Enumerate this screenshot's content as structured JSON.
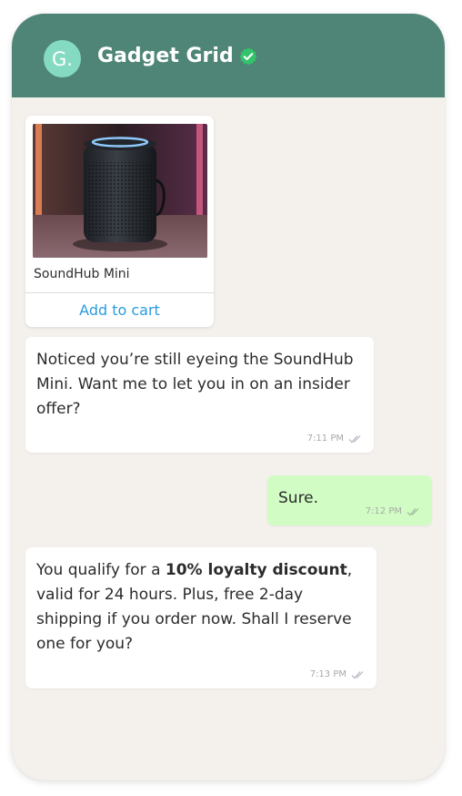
{
  "header": {
    "avatar_letter": "G.",
    "title": "Gadget Grid"
  },
  "product_card": {
    "name": "SoundHub Mini",
    "button_label": "Add to cart"
  },
  "messages": [
    {
      "direction": "incoming",
      "text": "Noticed you’re still eyeing the SoundHub Mini. Want me to let you in on an insider offer?",
      "time": "7:11 PM"
    },
    {
      "direction": "outgoing",
      "text": "Sure.",
      "time": "7:12 PM"
    },
    {
      "direction": "incoming",
      "text_before": "You qualify for a ",
      "text_bold": "10% loyalty discount",
      "text_after": ", valid for 24 hours. Plus, free 2-day shipping if you order now. Shall I reserve one for you?",
      "time": "7:13 PM"
    }
  ],
  "colors": {
    "header_bg": "#4f8577",
    "avatar_bg": "#85dbc1",
    "chat_bg": "#f4f1ed",
    "outgoing_bg": "#d1fdc4",
    "link": "#2a9be0",
    "verified": "#34c26a"
  },
  "icons": {
    "verified": "verified-badge-icon",
    "read_receipt": "double-check-icon"
  }
}
